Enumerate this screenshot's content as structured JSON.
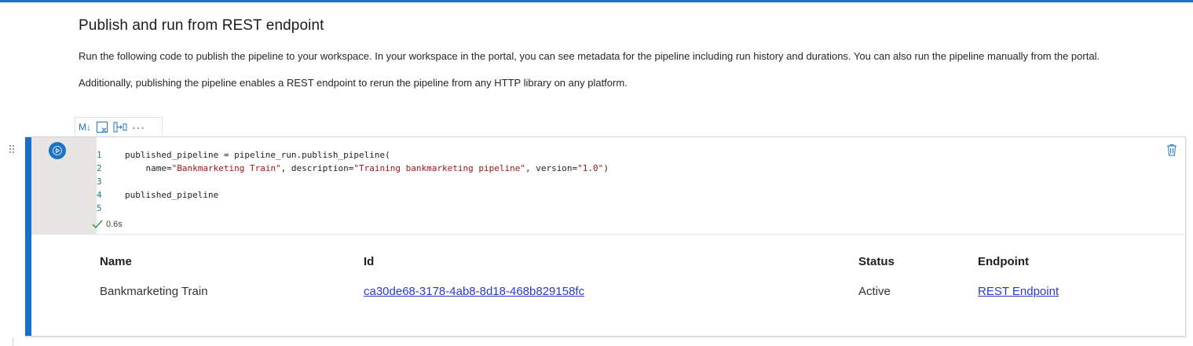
{
  "markdown": {
    "title": "Publish and run from REST endpoint",
    "paragraph1": "Run the following code to publish the pipeline to your workspace. In your workspace in the portal, you can see metadata for the pipeline including run history and durations. You can also run the pipeline manually from the portal.",
    "paragraph2": "Additionally, publishing the pipeline enables a REST endpoint to rerun the pipeline from any HTTP library on any platform."
  },
  "cell_toolbar": {
    "markdown_label": "M↓",
    "more_label": "···"
  },
  "code": {
    "lines": [
      {
        "num": "1",
        "text": "published_pipeline = pipeline_run.publish_pipeline("
      },
      {
        "num": "2",
        "pre": "    name=",
        "s1": "\"Bankmarketing Train\"",
        "mid1": ", description=",
        "s2": "\"Training bankmarketing pipeline\"",
        "mid2": ", version=",
        "s3": "\"1.0\"",
        "post": ")"
      },
      {
        "num": "3",
        "text": ""
      },
      {
        "num": "4",
        "text": "published_pipeline"
      },
      {
        "num": "5",
        "text": ""
      }
    ]
  },
  "execution": {
    "time": "0.6s"
  },
  "output": {
    "headers": {
      "name": "Name",
      "id": "Id",
      "status": "Status",
      "endpoint": "Endpoint"
    },
    "row": {
      "name": "Bankmarketing Train",
      "id": "ca30de68-3178-4ab8-8d18-468b829158fc",
      "status": "Active",
      "endpoint": "REST Endpoint"
    }
  },
  "colors": {
    "accent": "#1a73c8",
    "link": "#2a3bcb",
    "string": "#a31515",
    "line_number": "#237893"
  }
}
